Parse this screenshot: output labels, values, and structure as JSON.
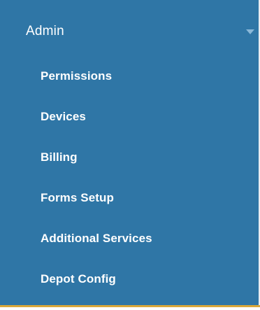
{
  "admin_menu": {
    "title": "Admin",
    "chevron_icon": "chevron-down-icon",
    "items": [
      {
        "label": "Permissions"
      },
      {
        "label": "Devices"
      },
      {
        "label": "Billing"
      },
      {
        "label": "Forms Setup"
      },
      {
        "label": "Additional Services"
      },
      {
        "label": "Depot Config"
      }
    ]
  },
  "colors": {
    "panel_background": "#2f76a6",
    "text": "#ffffff",
    "chevron": "#8ab8d8",
    "bottom_accent": "#d9a83a"
  }
}
